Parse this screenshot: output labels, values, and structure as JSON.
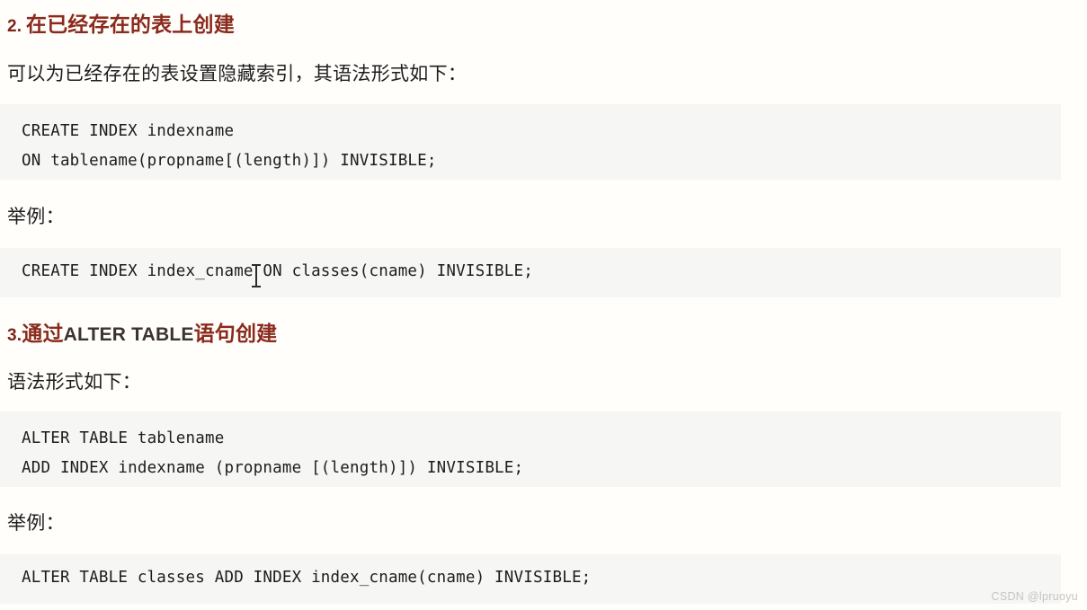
{
  "document": {
    "background_color": "#fffefb",
    "heading_color": "#8a2a1c",
    "code_background_color": "#f6f6f4",
    "body_text_color": "#1d1d1d"
  },
  "sections": [
    {
      "heading_number": "2.",
      "heading_text": "在已经存在的表上创建",
      "intro": "可以为已经存在的表设置隐藏索引，其语法形式如下：",
      "syntax_code": [
        "CREATE INDEX indexname",
        "ON tablename(propname[(length)]) INVISIBLE;"
      ],
      "example_label": "举例：",
      "example_code": [
        "CREATE INDEX index_cname ON classes(cname) INVISIBLE;"
      ]
    },
    {
      "heading_number": "3.",
      "heading_text_pre": "通过",
      "heading_text_latin": "ALTER TABLE",
      "heading_text_post": "语句创建",
      "intro": "语法形式如下：",
      "syntax_code": [
        "ALTER TABLE tablename",
        "ADD INDEX indexname (propname [(length)]) INVISIBLE;"
      ],
      "example_label": "举例：",
      "example_code": [
        "ALTER TABLE classes ADD INDEX index_cname(cname) INVISIBLE;"
      ]
    }
  ],
  "watermark": {
    "text": "CSDN @lpruoyu"
  }
}
